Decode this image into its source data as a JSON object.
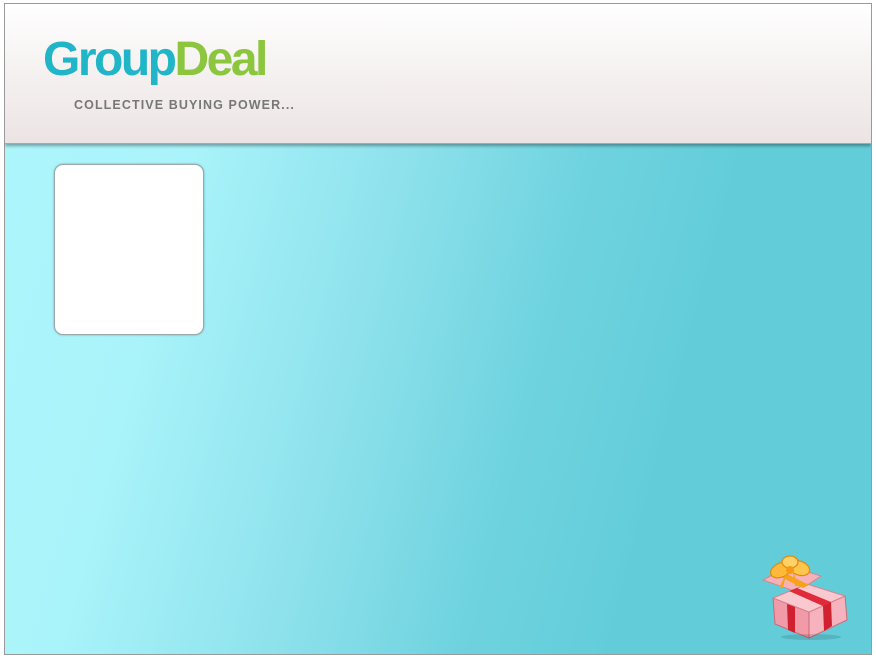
{
  "header": {
    "logo_part1": "Group",
    "logo_part2": "Deal",
    "tagline": "COLLECTIVE BUYING POWER..."
  },
  "colors": {
    "brand_teal": "#20b5c7",
    "brand_green": "#8cc63f",
    "background_light": "#aef6fc",
    "background_dark": "#62cdd9"
  },
  "icons": {
    "gift": "gift-box-icon"
  }
}
